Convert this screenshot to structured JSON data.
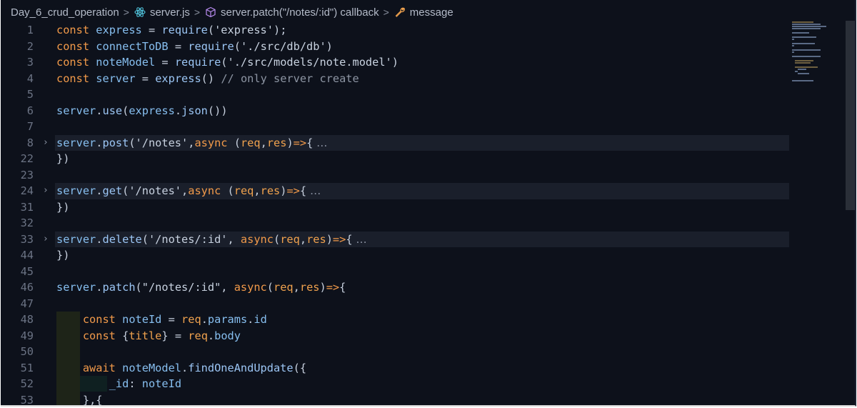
{
  "breadcrumb": {
    "folder": "Day_6_crud_operation",
    "file": "server.js",
    "symbol": "server.patch(\"/notes/:id\") callback",
    "leaf": "message",
    "separator": ">"
  },
  "colors": {
    "background": "#0d111b",
    "keyword": "#f29a4a",
    "variable": "#87bff0",
    "line_number": "#6b7384"
  },
  "editor": {
    "fold_ellipsis": "…",
    "lines": [
      {
        "n": "1",
        "code": "const express = require('express');"
      },
      {
        "n": "2",
        "code": "const connectToDB = require('./src/db/db')"
      },
      {
        "n": "3",
        "code": "const noteModel = require('./src/models/note.model')"
      },
      {
        "n": "4",
        "code": "const server = express() // only server create"
      },
      {
        "n": "5",
        "code": ""
      },
      {
        "n": "6",
        "code": "server.use(express.json())"
      },
      {
        "n": "7",
        "code": ""
      },
      {
        "n": "8",
        "code": "server.post('/notes',async (req,res)=>{",
        "folded": true
      },
      {
        "n": "22",
        "code": "})"
      },
      {
        "n": "23",
        "code": ""
      },
      {
        "n": "24",
        "code": "server.get('/notes',async (req,res)=>{",
        "folded": true
      },
      {
        "n": "31",
        "code": "})"
      },
      {
        "n": "32",
        "code": ""
      },
      {
        "n": "33",
        "code": "server.delete('/notes/:id', async(req,res)=>{",
        "folded": true
      },
      {
        "n": "44",
        "code": "})"
      },
      {
        "n": "45",
        "code": ""
      },
      {
        "n": "46",
        "code": "server.patch(\"/notes/:id\", async(req,res)=>{"
      },
      {
        "n": "47",
        "code": ""
      },
      {
        "n": "48",
        "code": "    const noteId = req.params.id"
      },
      {
        "n": "49",
        "code": "    const {title} = req.body"
      },
      {
        "n": "50",
        "code": ""
      },
      {
        "n": "51",
        "code": "    await noteModel.findOneAndUpdate({"
      },
      {
        "n": "52",
        "code": "        _id: noteId"
      },
      {
        "n": "53",
        "code": "    },{"
      }
    ]
  }
}
